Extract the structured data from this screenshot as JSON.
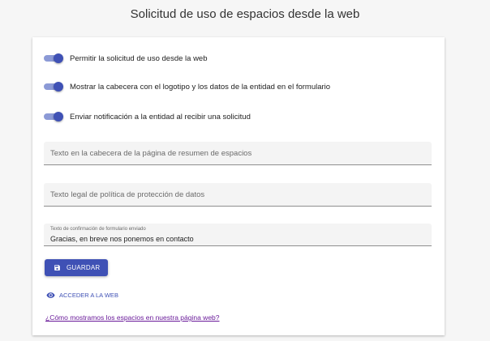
{
  "page": {
    "title": "Solicitud de uso de espacios desde la web"
  },
  "toggles": [
    {
      "label": "Permitir la solicitud de uso desde la web",
      "checked": true
    },
    {
      "label": "Mostrar la cabecera con el logotipo y los datos de la entidad en el formulario",
      "checked": true
    },
    {
      "label": "Enviar notificación a la entidad al recibir una solicitud",
      "checked": true
    }
  ],
  "fields": {
    "header_text": {
      "placeholder": "Texto en la cabecera de la página de resumen de espacios",
      "value": ""
    },
    "legal_text": {
      "placeholder": "Texto legal de política de protección de datos",
      "value": ""
    },
    "confirmation_text": {
      "label": "Texto de confirmación de formulario enviado",
      "value": "Gracias, en breve nos ponemos en contacto"
    }
  },
  "actions": {
    "save_label": "GUARDAR",
    "web_link_label": "ACCEDER A LA WEB",
    "help_link_label": "¿Cómo mostramos los espacios en nuestra página web?"
  },
  "icons": {
    "save": "save-icon",
    "web": "eye-icon"
  },
  "colors": {
    "primary": "#3f51b5",
    "switch_track": "#8c9ad6",
    "visited_link": "#6a1b9a"
  }
}
